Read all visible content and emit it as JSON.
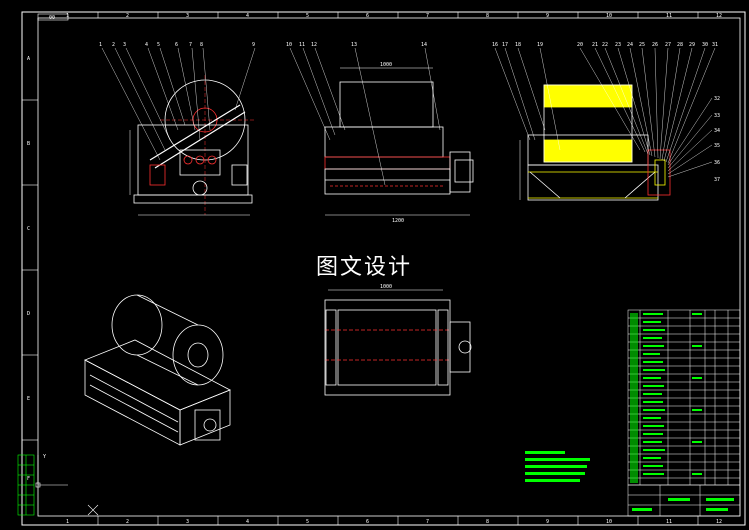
{
  "drawing": {
    "title_watermark": "图文设计",
    "top_left_tag": "00",
    "border_numbers_top": [
      "1",
      "2",
      "3",
      "4",
      "5",
      "6",
      "7",
      "8",
      "9",
      "10",
      "11",
      "12"
    ],
    "border_numbers_bottom": [
      "1",
      "2",
      "3",
      "4",
      "5",
      "6",
      "7",
      "8",
      "9",
      "10",
      "11",
      "12"
    ],
    "border_letters_left": [
      "A",
      "B",
      "C",
      "D",
      "E",
      "F"
    ],
    "view1_callouts": [
      "1",
      "2",
      "3",
      "4",
      "5",
      "6",
      "7",
      "8",
      "9"
    ],
    "view2_callouts": [
      "10",
      "11",
      "12",
      "13",
      "14"
    ],
    "view2_dim_top": "1000",
    "view2_dim_bottom": "1200",
    "view3_callouts": [
      "16",
      "17",
      "18",
      "19",
      "20",
      "21",
      "22",
      "23",
      "24",
      "25",
      "26",
      "27",
      "28",
      "29",
      "30",
      "31",
      "32",
      "33",
      "34",
      "35",
      "36",
      "37"
    ],
    "view4_dim_top": "1000",
    "ucs_axis_label": "Y"
  },
  "colors": {
    "line_white": "#ffffff",
    "accent_red": "#ff3030",
    "yellow_fill": "#ffff00",
    "note_green": "#00ff00",
    "hidden_cyan": "#00c8ff"
  }
}
